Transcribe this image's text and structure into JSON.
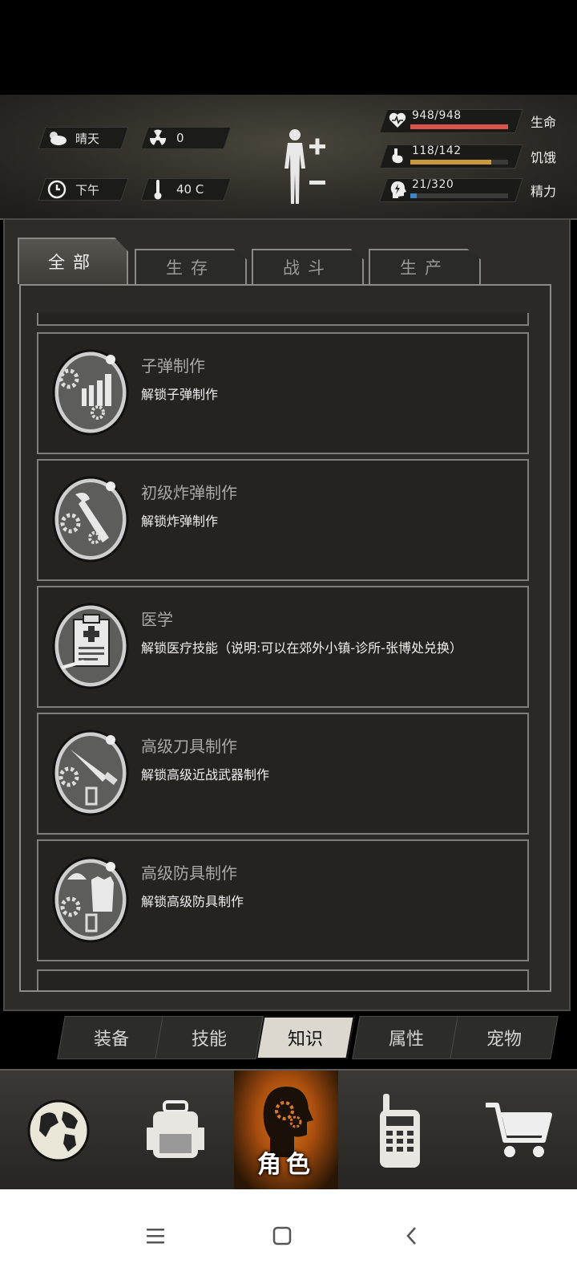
{
  "status": {
    "weather": "晴天",
    "radiation": "0",
    "time_of_day": "下午",
    "temperature": "40 C"
  },
  "stats": [
    {
      "label": "生命",
      "value": "948/948",
      "current": 948,
      "max": 948,
      "color": "#d9534a",
      "icon": "heart-icon"
    },
    {
      "label": "饥饿",
      "value": "118/142",
      "current": 118,
      "max": 142,
      "color": "#c99a3c",
      "icon": "stomach-icon"
    },
    {
      "label": "精力",
      "value": "21/320",
      "current": 21,
      "max": 320,
      "color": "#3f86c9",
      "icon": "energy-head-icon"
    }
  ],
  "tabs": [
    {
      "label": "全部",
      "active": true
    },
    {
      "label": "生存",
      "active": false
    },
    {
      "label": "战斗",
      "active": false
    },
    {
      "label": "生产",
      "active": false
    }
  ],
  "items": [
    {
      "title": "子弹制作",
      "desc": "解锁子弹制作",
      "icon": "bullet-crafting-icon"
    },
    {
      "title": "初级炸弹制作",
      "desc": "解锁炸弹制作",
      "icon": "bomb-crafting-icon"
    },
    {
      "title": "医学",
      "desc": "解锁医疗技能（说明:可以在郊外小镇-诊所-张博处兑换）",
      "icon": "medicine-icon"
    },
    {
      "title": "高级刀具制作",
      "desc": "解锁高级近战武器制作",
      "icon": "knife-crafting-icon"
    },
    {
      "title": "高级防具制作",
      "desc": "解锁高级防具制作",
      "icon": "armor-crafting-icon"
    }
  ],
  "subnav": [
    {
      "label": "装备",
      "active": false
    },
    {
      "label": "技能",
      "active": false
    },
    {
      "label": "知识",
      "active": true
    },
    {
      "label": "属性",
      "active": false
    },
    {
      "label": "宠物",
      "active": false
    }
  ],
  "bottomnav": [
    {
      "icon": "globe-icon",
      "label": "",
      "active": false
    },
    {
      "icon": "backpack-icon",
      "label": "",
      "active": false
    },
    {
      "icon": "character-head-icon",
      "label": "角色",
      "active": true
    },
    {
      "icon": "walkie-talkie-icon",
      "label": "",
      "active": false
    },
    {
      "icon": "shopping-cart-icon",
      "label": "",
      "active": false
    }
  ],
  "system_nav": [
    "menu-icon",
    "home-icon",
    "back-icon"
  ]
}
